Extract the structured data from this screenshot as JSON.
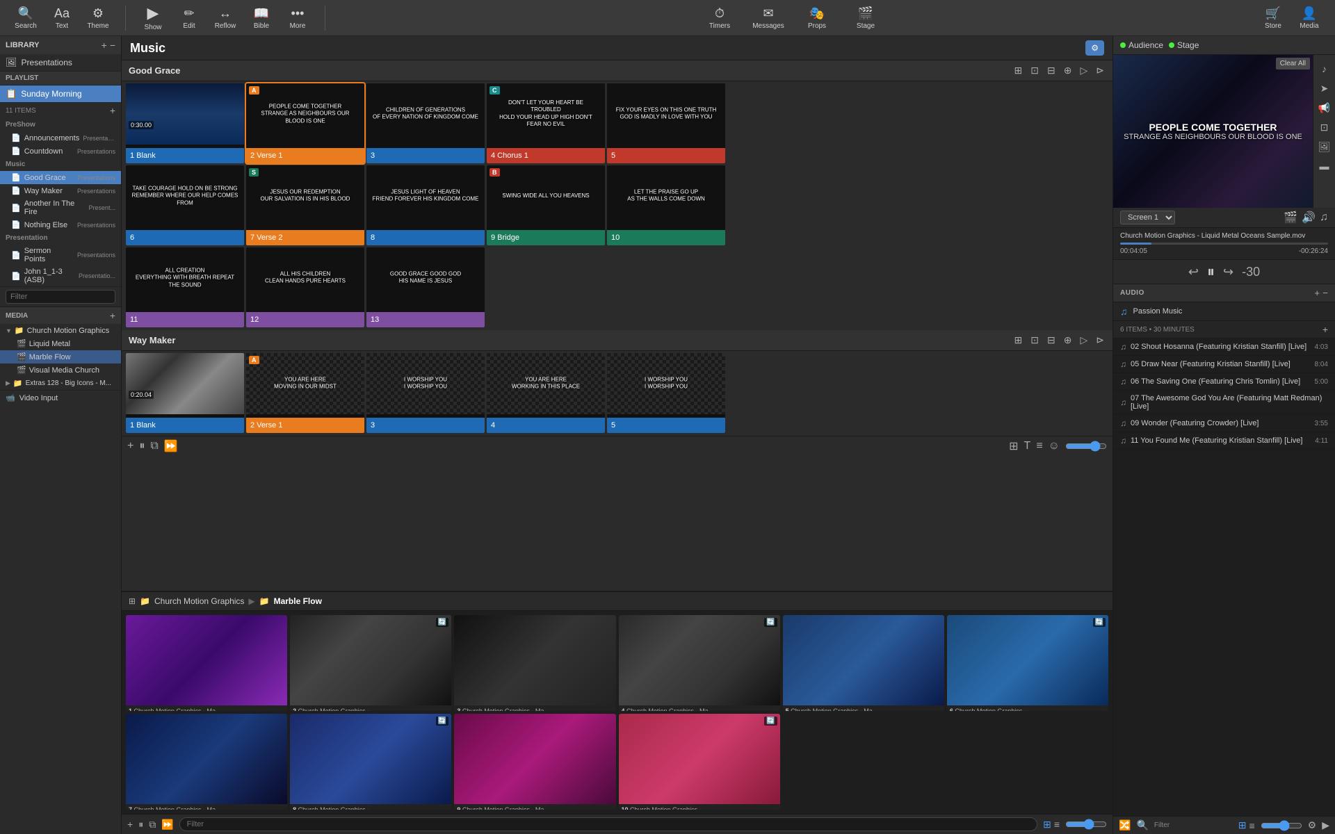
{
  "toolbar": {
    "left_buttons": [
      {
        "icon": "🔍",
        "label": "Search",
        "name": "search"
      },
      {
        "icon": "Aa",
        "label": "Text",
        "name": "text"
      },
      {
        "icon": "⚙",
        "label": "Theme",
        "name": "theme"
      }
    ],
    "main_buttons": [
      {
        "icon": "▶",
        "label": "Show",
        "name": "show"
      },
      {
        "icon": "✏",
        "label": "Edit",
        "name": "edit"
      },
      {
        "icon": "↔",
        "label": "Reflow",
        "name": "reflow"
      },
      {
        "icon": "📖",
        "label": "Bible",
        "name": "bible"
      },
      {
        "icon": "•••",
        "label": "More",
        "name": "more"
      }
    ],
    "center_buttons": [
      {
        "icon": "⏱",
        "label": "Timers",
        "name": "timers"
      },
      {
        "icon": "✈",
        "label": "Messages",
        "name": "messages"
      },
      {
        "icon": "🎭",
        "label": "Props",
        "name": "props"
      },
      {
        "icon": "🎬",
        "label": "Stage",
        "name": "stage"
      }
    ],
    "right_buttons": [
      {
        "icon": "🛒",
        "label": "Store",
        "name": "store"
      },
      {
        "icon": "👤",
        "label": "Media",
        "name": "media"
      }
    ]
  },
  "sidebar": {
    "library_label": "LIBRARY",
    "presentations_label": "Presentations",
    "playlist_label": "PLAYLIST",
    "playlist_name": "Sunday Morning",
    "items_count": "11 ITEMS",
    "sections": {
      "preshow": {
        "label": "PreShow",
        "items": [
          {
            "label": "Announcements",
            "sub": "Presentatio...",
            "icon": "📄"
          },
          {
            "label": "Countdown",
            "sub": "Presentations",
            "icon": "📄"
          }
        ]
      },
      "music": {
        "label": "Music",
        "items": [
          {
            "label": "Good Grace",
            "sub": "Presentations",
            "icon": "📄",
            "active": true
          },
          {
            "label": "Way Maker",
            "sub": "Presentations",
            "icon": "📄"
          },
          {
            "label": "Another In The Fire",
            "sub": "Present...",
            "icon": "📄"
          },
          {
            "label": "Nothing Else",
            "sub": "Presentations",
            "icon": "📄"
          }
        ]
      },
      "presentation": {
        "label": "Presentation",
        "items": [
          {
            "label": "Sermon Points",
            "sub": "Presentations",
            "icon": "📄"
          },
          {
            "label": "John 1_1-3 (ASB)",
            "sub": "Presentatio...",
            "icon": "📄"
          }
        ]
      }
    },
    "filter_placeholder": "Filter",
    "media_label": "MEDIA",
    "media_items": [
      {
        "label": "Church Motion Graphics",
        "expanded": true,
        "children": [
          {
            "label": "Liquid Metal",
            "icon": "🎬"
          },
          {
            "label": "Marble Flow",
            "icon": "🎬",
            "selected": true
          },
          {
            "label": "Visual Media Church",
            "icon": "🎬"
          }
        ]
      },
      {
        "label": "Extras 128 - Big Icons - M...",
        "icon": "📁"
      }
    ],
    "video_input_label": "Video Input"
  },
  "music_section": {
    "title": "Music",
    "good_grace": {
      "section_title": "Good Grace",
      "slides": [
        {
          "num": 1,
          "label": "Blank",
          "label_color": "blue",
          "has_timestamp": true,
          "timestamp": "0:30.00",
          "bg": "wave-blue",
          "text": ""
        },
        {
          "num": 2,
          "label": "Verse 1",
          "label_color": "orange",
          "badge": "A",
          "badge_color": "orange",
          "bg": "dark",
          "text": "PEOPLE COME TOGETHER\nSTRANGE AS NEIGHBOURS OUR BLOOD IS ONE",
          "active": true
        },
        {
          "num": 3,
          "label": "",
          "label_color": "blue",
          "bg": "dark",
          "text": "CHILDREN OF GENERATIONS\nOF EVERY NATION OF KINGDOM COME"
        },
        {
          "num": 4,
          "label": "Chorus 1",
          "label_color": "pink",
          "badge": "C",
          "badge_color": "cyan",
          "bg": "dark",
          "text": "DON'T LET YOUR HEART BE TROUBLED\nHOLD YOUR HEAD UP HIGH DON'T FEAR NO EVIL"
        },
        {
          "num": 5,
          "label": "",
          "label_color": "pink",
          "bg": "dark",
          "text": "FIX YOUR EYES ON THIS ONE TRUTH\nGOD IS MADLY IN LOVE WITH YOU"
        },
        {
          "num": 6,
          "label": "",
          "label_color": "blue",
          "bg": "dark",
          "text": "TAKE COURAGE HOLD ON BE STRONG\nREMEMBER WHERE OUR HELP COMES FROM"
        },
        {
          "num": 7,
          "label": "Verse 2",
          "label_color": "orange",
          "badge": "S",
          "badge_color": "teal",
          "bg": "dark",
          "text": "JESUS OUR REDEMPTION\nOUR SALVATION IS IN HIS BLOOD"
        },
        {
          "num": 8,
          "label": "",
          "label_color": "blue",
          "bg": "dark",
          "text": "JESUS LIGHT OF HEAVEN\nFRIEND FOREVER HIS KINGDOM COME"
        },
        {
          "num": 9,
          "label": "Bridge",
          "label_color": "teal",
          "badge": "B",
          "badge_color": "pink",
          "bg": "dark",
          "text": "SWING WIDE ALL YOU HEAVENS"
        },
        {
          "num": 10,
          "label": "",
          "label_color": "teal",
          "bg": "dark",
          "text": "LET THE PRAISE GO UP\nAS THE WALLS COME DOWN"
        },
        {
          "num": 11,
          "label": "",
          "label_color": "purple",
          "bg": "dark",
          "text": "ALL CREATION\nEVERYTHING WITH BREATH REPEAT THE SOUND"
        },
        {
          "num": 12,
          "label": "",
          "label_color": "purple",
          "bg": "dark",
          "text": "ALL HIS CHILDREN\nCLEAN HANDS PURE HEARTS"
        },
        {
          "num": 13,
          "label": "",
          "label_color": "purple",
          "bg": "dark",
          "text": "GOOD GRACE GOOD GOD\nHIS NAME IS JESUS"
        }
      ]
    },
    "way_maker": {
      "section_title": "Way Maker",
      "slides": [
        {
          "num": 1,
          "label": "Blank",
          "label_color": "blue",
          "has_timestamp": true,
          "timestamp": "0:20.04",
          "bg": "clouds-bw",
          "text": ""
        },
        {
          "num": 2,
          "label": "Verse 1",
          "label_color": "orange",
          "badge": "A",
          "badge_color": "orange",
          "bg": "checker",
          "text": "YOU ARE HERE\nMOVING IN OUR MIDST"
        },
        {
          "num": 3,
          "label": "",
          "label_color": "blue",
          "bg": "checker",
          "text": "I WORSHIP YOU\nI WORSHIP YOU"
        },
        {
          "num": 4,
          "label": "",
          "label_color": "blue",
          "bg": "checker",
          "text": "YOU ARE HERE\nWORKING IN THIS PLACE"
        },
        {
          "num": 5,
          "label": "",
          "label_color": "blue",
          "bg": "checker",
          "text": "I WORSHIP YOU\nI WORSHIP YOU"
        }
      ]
    }
  },
  "media_browser": {
    "breadcrumb": [
      "Church Motion Graphics",
      "Marble Flow"
    ],
    "breadcrumb_icons": [
      "folder",
      "folder"
    ],
    "items": [
      {
        "num": 1,
        "label": "Church Motion Graphics - Ma...",
        "bg": "purple",
        "has_loop": false
      },
      {
        "num": 2,
        "label": "Church Motion Graphics - Ma...",
        "bg": "dark-marble",
        "has_loop": true
      },
      {
        "num": 3,
        "label": "Church Motion Graphics - Ma...",
        "bg": "dark-wave",
        "has_loop": false
      },
      {
        "num": 4,
        "label": "Church Motion Graphics - Ma...",
        "bg": "dark-marble2",
        "has_loop": true
      },
      {
        "num": 5,
        "label": "Church Motion Graphics - Ma...",
        "bg": "blue-marble",
        "has_loop": false
      },
      {
        "num": 6,
        "label": "Church Motion Graphics - Ma...",
        "bg": "blue-ocean",
        "has_loop": true
      },
      {
        "num": 7,
        "label": "Church Motion Graphics - Ma...",
        "bg": "deep-blue",
        "has_loop": false
      },
      {
        "num": 8,
        "label": "Church Motion Graphics - Ma...",
        "bg": "blue-flow",
        "has_loop": true
      },
      {
        "num": 9,
        "label": "Church Motion Graphics - Ma...",
        "bg": "pink-purple",
        "has_loop": false
      },
      {
        "num": 10,
        "label": "Church Motion Graphics - ...",
        "bg": "pink-red",
        "has_loop": true
      }
    ],
    "filter_placeholder": "Filter"
  },
  "right_panel": {
    "audience_label": "Audience",
    "stage_label": "Stage",
    "preview_text_main": "PEOPLE COME TOGETHER",
    "preview_text_sub": "STRANGE AS NEIGHBOURS OUR BLOOD IS ONE",
    "clear_label": "Clear All",
    "screen_label": "Screen 1",
    "video_title": "Church Motion Graphics - Liquid Metal Oceans Sample.mov",
    "time_current": "00:04:05",
    "time_remaining": "-00:26:24",
    "audio_section_label": "AUDIO",
    "audio_item": "Passion Music",
    "tracks_count": "6 ITEMS • 30 MINUTES",
    "tracks": [
      {
        "icon": "♫",
        "label": "02 Shout Hosanna (Featuring Kristian Stanfill) [Live]",
        "duration": "4:03"
      },
      {
        "icon": "♫",
        "label": "05 Draw Near (Featuring Kristian Stanfill) [Live]",
        "duration": "8:04"
      },
      {
        "icon": "♫",
        "label": "06 The Saving One (Featuring Chris Tomlin) [Live]",
        "duration": "5:00"
      },
      {
        "icon": "♫",
        "label": "07 The Awesome God You Are (Featuring Matt Redman) [Live]",
        "duration": ""
      },
      {
        "icon": "♫",
        "label": "09 Wonder (Featuring Crowder) [Live]",
        "duration": "3:55"
      },
      {
        "icon": "♫",
        "label": "11 You Found Me (Featuring Kristian Stanfill) [Live]",
        "duration": "4:11"
      }
    ]
  }
}
